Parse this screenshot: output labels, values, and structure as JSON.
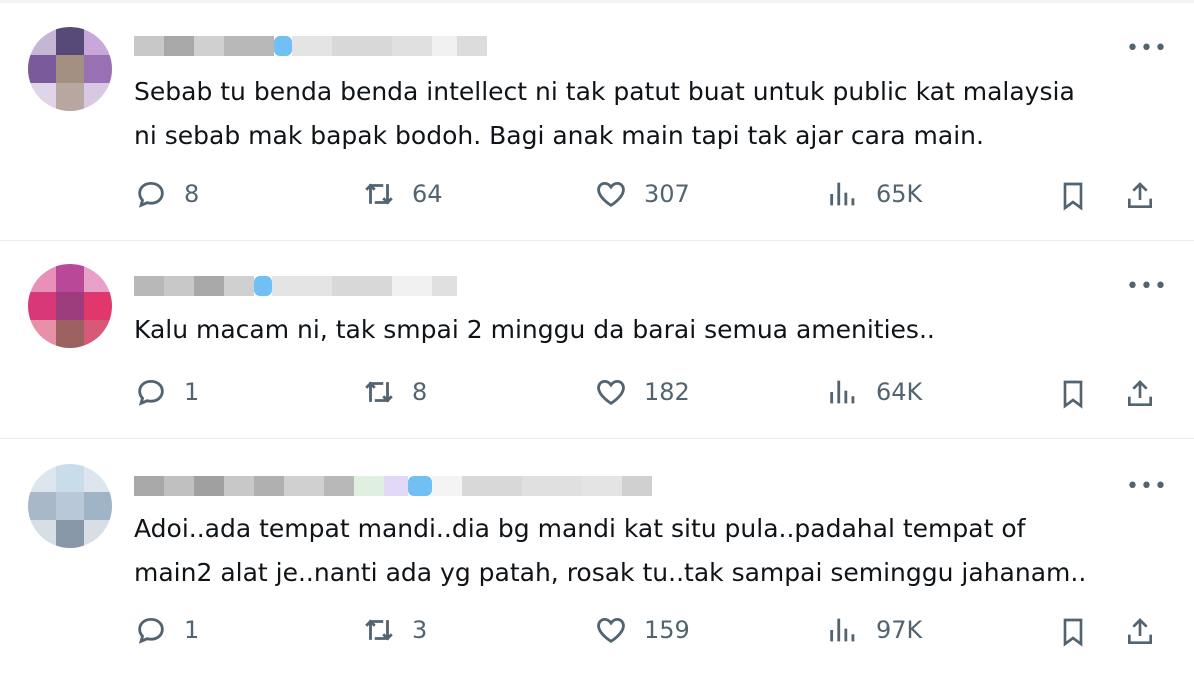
{
  "tweets": [
    {
      "text": "Sebab tu benda benda intellect ni tak patut buat untuk public kat malaysia\nni sebab mak bapak bodoh. Bagi anak main tapi tak ajar cara main.",
      "replies": "8",
      "retweets": "64",
      "likes": "307",
      "views": "65K",
      "avatar_colors": [
        "#c6b6d6",
        "#584a78",
        "#c8a8d8",
        "#7a5a9a",
        "#a49080",
        "#9a70b4",
        "#e0d4e8",
        "#b8a6a0",
        "#d8c8e4"
      ]
    },
    {
      "text": "Kalu macam ni, tak smpai 2 minggu da barai semua amenities..",
      "replies": "1",
      "retweets": "8",
      "likes": "182",
      "views": "64K",
      "avatar_colors": [
        "#e890b8",
        "#b84898",
        "#e8a0c8",
        "#d83878",
        "#9c3c7c",
        "#e0386c",
        "#e890a8",
        "#9c6060",
        "#d85878"
      ]
    },
    {
      "text": "Adoi..ada tempat mandi..dia bg mandi kat situ pula..padahal tempat of\nmain2 alat je..nanti ada yg patah, rosak tu..tak sampai seminggu jahanam..",
      "replies": "1",
      "retweets": "3",
      "likes": "159",
      "views": "97K",
      "avatar_colors": [
        "#dde6ee",
        "#c8dcea",
        "#dde6ee",
        "#a8b8c8",
        "#b8c8d8",
        "#a0b4c8",
        "#d8dee6",
        "#8898a8",
        "#d8dee6"
      ]
    }
  ],
  "icons": {
    "more": "more-icon",
    "reply": "reply-icon",
    "retweet": "retweet-icon",
    "like": "heart-icon",
    "views": "views-icon",
    "bookmark": "bookmark-icon",
    "share": "share-icon"
  },
  "colors": {
    "text": "#0f1419",
    "muted": "#536471",
    "divider": "#e6ecf0",
    "verified": "#70bff5"
  }
}
